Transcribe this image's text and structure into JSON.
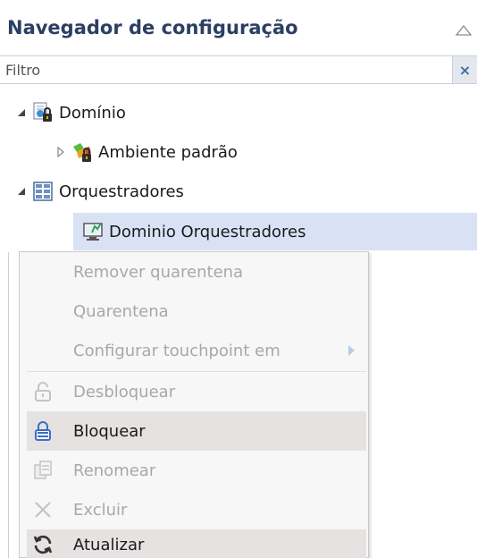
{
  "panel": {
    "title": "Navegador de configuração"
  },
  "filter": {
    "placeholder": "Filtro",
    "clear_label": "×"
  },
  "tree": {
    "items": [
      {
        "label": "Domínio",
        "icon": "domain-lock-icon",
        "expanded": true
      },
      {
        "label": "Ambiente padrão",
        "icon": "environment-lock-icon",
        "expanded": false
      },
      {
        "label": "Orquestradores",
        "icon": "orchestrators-icon",
        "expanded": true
      },
      {
        "label": "Dominio Orquestradores",
        "icon": "orchestrator-domain-icon",
        "selected": true
      }
    ]
  },
  "context_menu": {
    "items": [
      {
        "label": "Remover quarentena",
        "enabled": false
      },
      {
        "label": "Quarentena",
        "enabled": false
      },
      {
        "label": "Configurar touchpoint em",
        "enabled": false,
        "submenu": true
      },
      {
        "label": "Desbloquear",
        "enabled": false,
        "icon": "unlock-icon"
      },
      {
        "label": "Bloquear",
        "enabled": true,
        "icon": "lock-icon",
        "highlighted": true
      },
      {
        "label": "Renomear",
        "enabled": false,
        "icon": "rename-icon"
      },
      {
        "label": "Excluir",
        "enabled": false,
        "icon": "delete-icon"
      },
      {
        "label": "Atualizar",
        "enabled": true,
        "icon": "refresh-icon",
        "highlighted": true
      }
    ]
  },
  "colors": {
    "title": "#2c3e63",
    "selection": "#d9e1f5",
    "menu_background": "#f7f7f7",
    "menu_hover": "#e6e2e2",
    "disabled_text": "#a8a8a8"
  }
}
